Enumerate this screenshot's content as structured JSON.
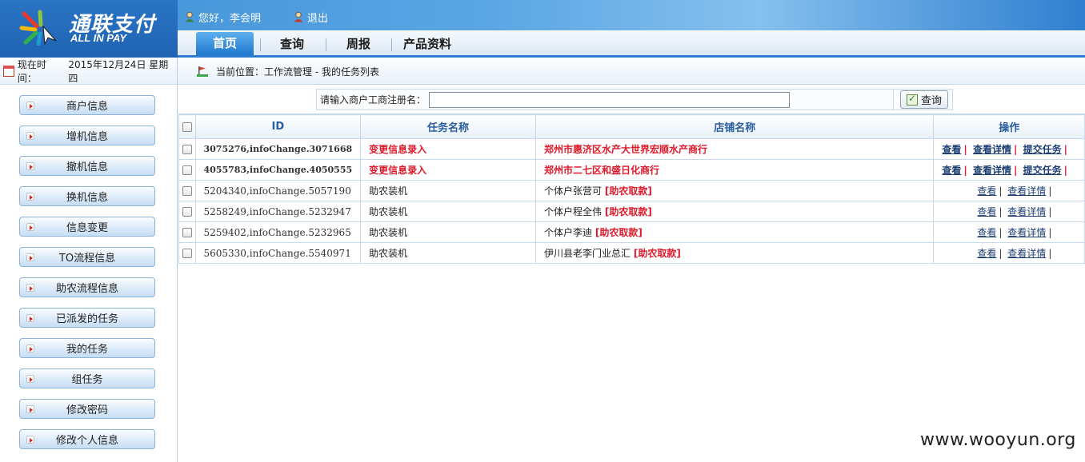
{
  "header": {
    "logo_cn": "通联支付",
    "logo_en": "ALL IN PAY",
    "greeting": "您好，李会明",
    "logout": "退出",
    "tabs": [
      {
        "label": "首页",
        "active": true
      },
      {
        "label": "查询",
        "active": false
      },
      {
        "label": "周报",
        "active": false
      },
      {
        "label": "产品资料",
        "active": false
      }
    ]
  },
  "infobar": {
    "time_label": "现在时间：",
    "time_value": "2015年12月24日 星期四",
    "location": "当前位置：工作流管理 - 我的任务列表"
  },
  "sidebar": {
    "items": [
      "商户信息",
      "增机信息",
      "撤机信息",
      "换机信息",
      "信息变更",
      "TO流程信息",
      "助农流程信息",
      "已派发的任务",
      "我的任务",
      "组任务",
      "修改密码",
      "修改个人信息"
    ]
  },
  "search": {
    "label": "请输入商户工商注册名：",
    "value": "",
    "button": "查询"
  },
  "table": {
    "headers": [
      "ID",
      "任务名称",
      "店铺名称",
      "操作"
    ],
    "rows": [
      {
        "id": "3075276,infoChange.3071668",
        "task": "变更信息录入",
        "shop": "郑州市惠济区水产大世界宏顺水产商行",
        "tag": "",
        "red": true,
        "ops": [
          "查看",
          "查看详情",
          "提交任务"
        ]
      },
      {
        "id": "4055783,infoChange.4050555",
        "task": "变更信息录入",
        "shop": "郑州市二七区和盛日化商行",
        "tag": "",
        "red": true,
        "ops": [
          "查看",
          "查看详情",
          "提交任务"
        ]
      },
      {
        "id": "5204340,infoChange.5057190",
        "task": "助农装机",
        "shop": "个体户张营可",
        "tag": "[助农取款]",
        "red": false,
        "ops": [
          "查看",
          "查看详情"
        ]
      },
      {
        "id": "5258249,infoChange.5232947",
        "task": "助农装机",
        "shop": "个体户程全伟",
        "tag": "[助农取款]",
        "red": false,
        "ops": [
          "查看",
          "查看详情"
        ]
      },
      {
        "id": "5259402,infoChange.5232965",
        "task": "助农装机",
        "shop": "个体户李迪",
        "tag": "[助农取款]",
        "red": false,
        "ops": [
          "查看",
          "查看详情"
        ]
      },
      {
        "id": "5605330,infoChange.5540971",
        "task": "助农装机",
        "shop": "伊川县老李门业总汇",
        "tag": "[助农取款]",
        "red": false,
        "ops": [
          "查看",
          "查看详情"
        ]
      }
    ]
  },
  "watermark": "www.wooyun.org",
  "colors": {
    "accent": "#2d7ccf",
    "alert": "#e0192a",
    "link": "#1d3e73"
  }
}
